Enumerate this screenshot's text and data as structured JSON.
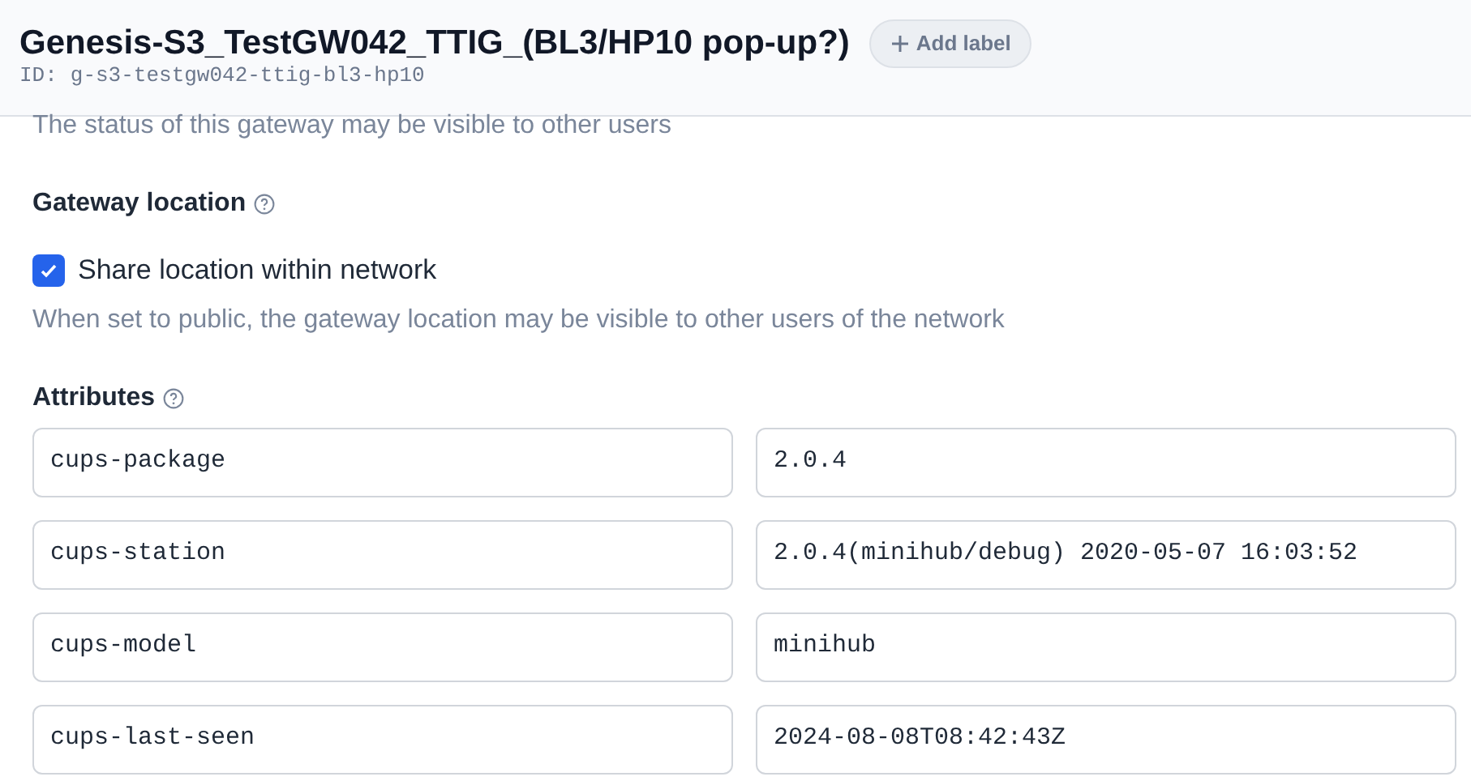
{
  "header": {
    "title": "Genesis-S3_TestGW042_TTIG_(BL3/HP10 pop-up?)",
    "add_label": "Add label",
    "id_label": "ID:",
    "id_value": "g-s3-testgw042-ttig-bl3-hp10"
  },
  "status_note": "The status of this gateway may be visible to other users",
  "location": {
    "heading": "Gateway location",
    "share": {
      "label": "Share location within network",
      "checked": true
    },
    "note": "When set to public, the gateway location may be visible to other users of the network"
  },
  "attributes": {
    "heading": "Attributes",
    "rows": [
      {
        "key": "cups-package",
        "value": "2.0.4"
      },
      {
        "key": "cups-station",
        "value": "2.0.4(minihub/debug) 2020-05-07 16:03:52"
      },
      {
        "key": "cups-model",
        "value": "minihub"
      },
      {
        "key": "cups-last-seen",
        "value": "2024-08-08T08:42:43Z"
      }
    ]
  }
}
